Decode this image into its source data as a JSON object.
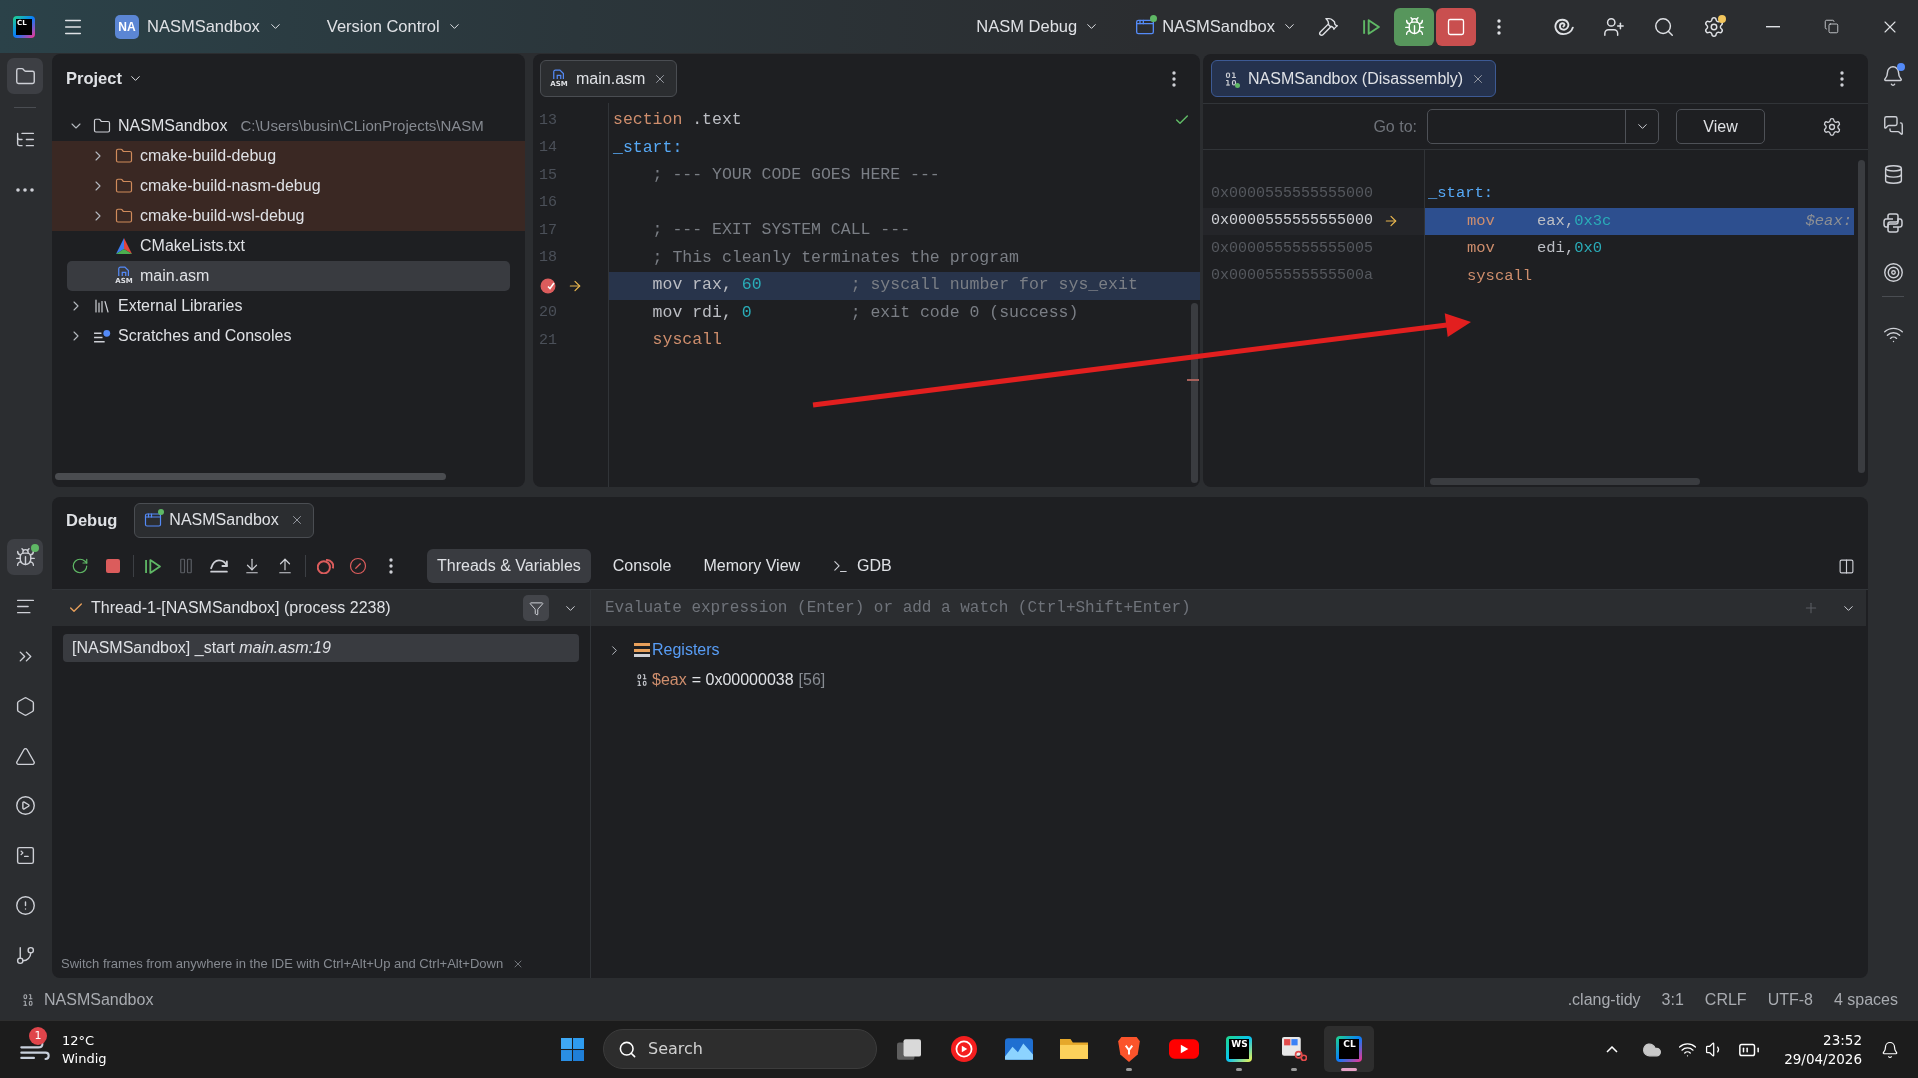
{
  "title_bar": {
    "logo": "CL",
    "project_badge": "NA",
    "project": "NASMSandbox",
    "vcs": "Version Control",
    "run_config": "NASM Debug",
    "run_target": "NASMSandbox",
    "session_running": true,
    "settings_badge": true
  },
  "left_toolbar": {
    "top": [
      {
        "kind": "project",
        "selected": true
      },
      {
        "kind": "structure",
        "selected": false
      },
      {
        "kind": "more",
        "selected": false
      }
    ],
    "bottom": [
      {
        "kind": "debug",
        "selected": true,
        "running": true
      },
      {
        "kind": "log",
        "selected": false,
        "running": false
      },
      {
        "kind": "services",
        "selected": false,
        "running": false
      },
      {
        "kind": "packages",
        "selected": false,
        "running": false
      },
      {
        "kind": "cmake",
        "selected": false,
        "running": false
      },
      {
        "kind": "run",
        "selected": false,
        "running": false
      },
      {
        "kind": "terminal",
        "selected": false,
        "running": false
      },
      {
        "kind": "problems",
        "selected": false,
        "running": false
      },
      {
        "kind": "git",
        "selected": false,
        "running": false
      }
    ]
  },
  "right_toolbar": {
    "notification_dot": true,
    "items": [
      {
        "kind": "notifications"
      },
      {
        "kind": "ai_chat"
      },
      {
        "kind": "database"
      },
      {
        "kind": "python"
      },
      {
        "kind": "target"
      },
      {
        "kind": "wifi"
      }
    ]
  },
  "project_panel": {
    "title": "Project",
    "tree": [
      {
        "label": "NASMSandbox",
        "path": "C:\\Users\\busin\\CLionProjects\\NASM",
        "kind": "module",
        "expanded": true,
        "selected": false,
        "children": [
          {
            "label": "cmake-build-debug",
            "kind": "excluded_folder",
            "expanded": false,
            "selected": false
          },
          {
            "label": "cmake-build-nasm-debug",
            "kind": "excluded_folder",
            "expanded": false,
            "selected": false
          },
          {
            "label": "cmake-build-wsl-debug",
            "kind": "excluded_folder",
            "expanded": false,
            "selected": false
          },
          {
            "label": "CMakeLists.txt",
            "kind": "cmake_file",
            "selected": false
          },
          {
            "label": "main.asm",
            "kind": "asm_file",
            "icon_label": "ASM",
            "selected": true
          }
        ]
      },
      {
        "label": "External Libraries",
        "kind": "libraries",
        "expanded": false,
        "selected": false
      },
      {
        "label": "Scratches and Consoles",
        "kind": "scratches",
        "expanded": false,
        "selected": false
      }
    ]
  },
  "editor": {
    "tabs": [
      {
        "label": "main.asm",
        "icon_label": "ASM",
        "selected": true
      }
    ],
    "inspection_ok": true,
    "lines": [
      {
        "number": "13",
        "breakpoint": false,
        "current": false,
        "tokens": [
          {
            "text": "section",
            "kind": "keyword"
          },
          {
            "text": " .text",
            "kind": "plain"
          }
        ]
      },
      {
        "number": "14",
        "breakpoint": false,
        "current": false,
        "tokens": [
          {
            "text": "_start:",
            "kind": "label"
          }
        ]
      },
      {
        "number": "15",
        "breakpoint": false,
        "current": false,
        "tokens": [
          {
            "text": "    ; --- YOUR CODE GOES HERE ---",
            "kind": "comment"
          }
        ]
      },
      {
        "number": "16",
        "breakpoint": false,
        "current": false
      },
      {
        "number": "17",
        "breakpoint": false,
        "current": false,
        "tokens": [
          {
            "text": "    ; --- EXIT SYSTEM CALL ---",
            "kind": "comment"
          }
        ]
      },
      {
        "number": "18",
        "breakpoint": false,
        "current": false,
        "tokens": [
          {
            "text": "    ; This cleanly terminates the program",
            "kind": "comment"
          }
        ]
      },
      {
        "breakpoint": true,
        "current": true,
        "tokens": [
          {
            "text": "    mov rax, ",
            "kind": "plain"
          },
          {
            "text": "60",
            "kind": "number"
          },
          {
            "text": "         ; syscall number for sys_exit",
            "kind": "comment"
          }
        ]
      },
      {
        "number": "20",
        "breakpoint": false,
        "current": false,
        "tokens": [
          {
            "text": "    mov rdi, ",
            "kind": "plain"
          },
          {
            "text": "0",
            "kind": "number"
          },
          {
            "text": "          ; exit code 0 (success)",
            "kind": "comment"
          }
        ]
      },
      {
        "number": "21",
        "breakpoint": false,
        "current": false,
        "tokens": [
          {
            "text": "    syscall",
            "kind": "keyword"
          }
        ]
      }
    ]
  },
  "disassembly": {
    "tab": {
      "label": "NASMSandbox (Disassembly)",
      "selected": true
    },
    "goto_label": "Go to:",
    "view_button": "View",
    "lines": [
      {
        "address": "0x0000555555555000",
        "kind": "label",
        "current": false,
        "text": "_start:"
      },
      {
        "address": "0x0000555555555000",
        "kind": "instruction",
        "current": true,
        "mnemonic": "mov",
        "operands": [
          {
            "text": "eax,",
            "kind": "register"
          },
          {
            "text": "0x3c",
            "kind": "number"
          }
        ],
        "hint": "$eax:"
      },
      {
        "address": "0x0000555555555005",
        "kind": "instruction",
        "current": false,
        "mnemonic": "mov",
        "operands": [
          {
            "text": "edi,",
            "kind": "register"
          },
          {
            "text": "0x0",
            "kind": "number"
          }
        ]
      },
      {
        "address": "0x000055555555500a",
        "kind": "instruction",
        "current": false,
        "mnemonic": "syscall"
      }
    ]
  },
  "debug": {
    "title": "Debug",
    "session_tab": {
      "label": "NASMSandbox",
      "selected": true
    },
    "toolbar": [
      {
        "kind": "rerun",
        "disabled": false
      },
      {
        "kind": "stop",
        "disabled": false
      },
      {
        "kind": "resume",
        "disabled": false
      },
      {
        "kind": "pause",
        "disabled": true
      },
      {
        "kind": "step_over",
        "disabled": false
      },
      {
        "kind": "step_into",
        "disabled": false
      },
      {
        "kind": "step_out",
        "disabled": false
      },
      {
        "kind": "breakpoints",
        "disabled": false
      },
      {
        "kind": "mute",
        "disabled": false
      },
      {
        "kind": "more",
        "disabled": false
      }
    ],
    "view_tabs": [
      {
        "label": "Threads & Variables",
        "kind": "plain",
        "selected": true
      },
      {
        "label": "Console",
        "kind": "plain",
        "selected": false
      },
      {
        "label": "Memory View",
        "kind": "plain",
        "selected": false
      },
      {
        "label": "GDB",
        "kind": "terminal",
        "selected": false
      }
    ],
    "thread": {
      "label": "Thread-1-[NASMSandbox] (process 2238)",
      "status_ok": true
    },
    "frames": [
      {
        "label": "[NASMSandbox] _start *main.asm:19*",
        "selected": true
      }
    ],
    "evaluate": {
      "placeholder": "Evaluate expression (Enter) or add a watch (Ctrl+Shift+Enter)"
    },
    "variables": [
      {
        "kind": "group",
        "name": "Registers",
        "expanded": false
      },
      {
        "kind": "value",
        "name": "$eax",
        "value": "= 0x00000038",
        "extra": "[56]"
      }
    ],
    "hint": "Switch frames from anywhere in the IDE with Ctrl+Alt+Up and Ctrl+Alt+Down"
  },
  "status_bar": {
    "project": "NASMSandbox",
    "items": [
      ".clang-tidy",
      "3:1",
      "CRLF",
      "UTF-8",
      "4 spaces"
    ]
  },
  "taskbar": {
    "weather": {
      "badge": "1",
      "temperature": "12°C",
      "condition": "Windig"
    },
    "search_placeholder": "Search",
    "apps": [
      {
        "kind": "task_view",
        "running": false,
        "active": false
      },
      {
        "kind": "music",
        "running": false,
        "active": false
      },
      {
        "kind": "photos",
        "running": false,
        "active": false
      },
      {
        "kind": "explorer",
        "running": false,
        "active": false
      },
      {
        "kind": "browser",
        "running": true,
        "active": false
      },
      {
        "kind": "video",
        "running": false,
        "active": false
      },
      {
        "kind": "ide_ws",
        "label": "WS",
        "running": true,
        "active": false
      },
      {
        "kind": "snipping",
        "running": true,
        "active": false
      },
      {
        "kind": "ide_cl",
        "label": "CL",
        "running": true,
        "active": true
      }
    ],
    "time": "23:52",
    "date": "29/04/2026"
  }
}
